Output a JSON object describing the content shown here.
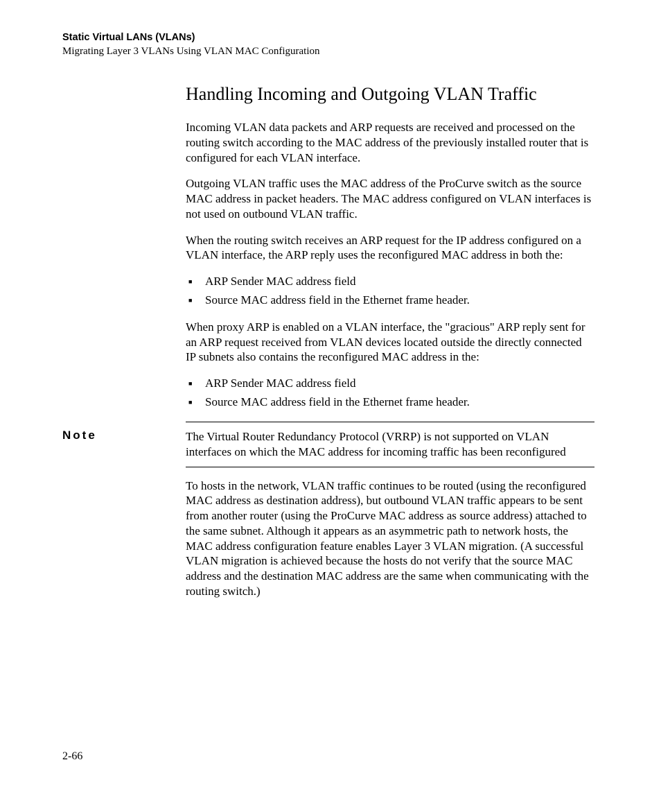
{
  "header": {
    "title": "Static Virtual LANs (VLANs)",
    "subtitle": "Migrating Layer 3 VLANs Using VLAN MAC Configuration"
  },
  "section_heading": "Handling Incoming and Outgoing VLAN Traffic",
  "paragraphs": {
    "p1": "Incoming VLAN data packets and ARP requests are received and processed on the routing switch according to the MAC address of the previously installed router that is configured for each VLAN interface.",
    "p2": "Outgoing VLAN traffic uses the MAC address of the ProCurve switch as the source MAC address in packet headers. The MAC address configured on VLAN interfaces is not used on outbound VLAN traffic.",
    "p3": "When the routing switch receives an ARP request for the IP address configured on a VLAN interface, the ARP reply uses the reconfigured MAC address in both the:",
    "p4": "When proxy ARP is enabled on a VLAN interface, the \"gracious\" ARP reply sent for an ARP request received from VLAN devices located outside the directly connected IP subnets also contains the reconfigured MAC address in the:",
    "p5": "To hosts in the network, VLAN traffic continues to be routed (using the reconfigured MAC address as destination address), but outbound VLAN traffic appears to be sent from another router (using the ProCurve MAC address as source address) attached to the same subnet. Although it appears as an asymmetric path to network hosts, the MAC address configuration feature enables Layer 3 VLAN migration. (A successful VLAN migration is achieved because the hosts do not verify that the source MAC address and the destination MAC address are the same when communicating with the routing switch.)"
  },
  "list1": {
    "i1": "ARP Sender MAC address field",
    "i2": "Source MAC address field in the Ethernet frame header."
  },
  "list2": {
    "i1": "ARP Sender MAC address field",
    "i2": "Source MAC address field in the Ethernet frame header."
  },
  "note": {
    "label": "Note",
    "text": "The Virtual Router Redundancy Protocol (VRRP) is not supported on VLAN interfaces on which the MAC address for incoming traffic has been reconfigured"
  },
  "page_number": "2-66"
}
